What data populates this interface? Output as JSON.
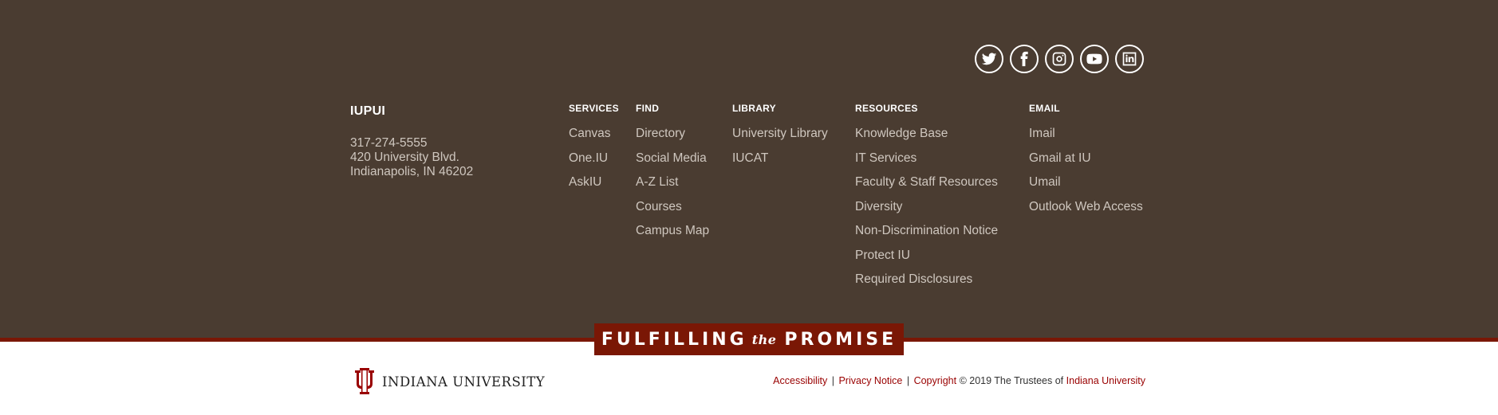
{
  "social": [
    {
      "name": "twitter-icon"
    },
    {
      "name": "facebook-icon"
    },
    {
      "name": "instagram-icon"
    },
    {
      "name": "youtube-icon"
    },
    {
      "name": "linkedin-icon"
    }
  ],
  "org": {
    "name": "IUPUI",
    "phone": "317-274-5555",
    "street": "420 University Blvd.",
    "city": "Indianapolis, IN 46202"
  },
  "columns": {
    "services": {
      "heading": "SERVICES",
      "links": [
        "Canvas",
        "One.IU",
        "AskIU"
      ]
    },
    "find": {
      "heading": "FIND",
      "links": [
        "Directory",
        "Social Media",
        "A-Z List",
        "Courses",
        "Campus Map"
      ]
    },
    "library": {
      "heading": "LIBRARY",
      "links": [
        "University Library",
        "IUCAT"
      ]
    },
    "resources": {
      "heading": "RESOURCES",
      "links": [
        "Knowledge Base",
        "IT Services",
        "Faculty & Staff Resources",
        "Diversity",
        "Non-Discrimination Notice",
        "Protect IU",
        "Required Disclosures"
      ]
    },
    "email": {
      "heading": "EMAIL",
      "links": [
        "Imail",
        "Gmail at IU",
        "Umail",
        "Outlook Web Access"
      ]
    }
  },
  "banner": {
    "left": "FULFILLING",
    "the": "the",
    "right": "PROMISE"
  },
  "iu": {
    "wordmark": "INDIANA UNIVERSITY"
  },
  "legal": {
    "accessibility": "Accessibility",
    "privacy": "Privacy Notice",
    "copyright": "Copyright",
    "copyright_text": "© 2019 The Trustees of",
    "iu_link": "Indiana University",
    "sep": "|"
  },
  "colors": {
    "footer_bg": "#4a3c31",
    "crimson": "#7a1705",
    "link_red": "#990000"
  }
}
